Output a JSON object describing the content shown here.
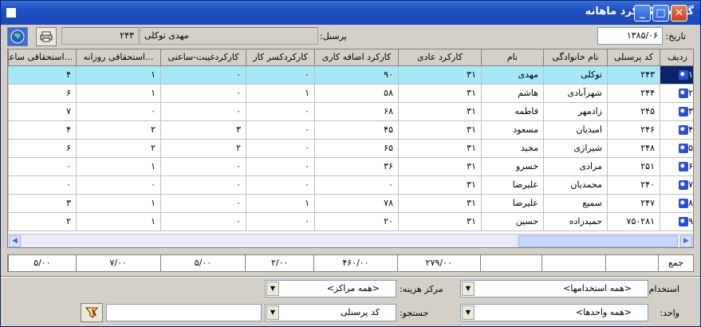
{
  "window": {
    "title": "گزارش کارکرد ماهانه"
  },
  "header": {
    "date_label": "تاریخ:",
    "date_value": "۱۳۸۵/۰۶",
    "personnel_label": "پرسنل:",
    "personnel_name": "مهدی   توکلی",
    "personnel_code": "۲۴۳"
  },
  "grid": {
    "columns": [
      "ردیف",
      "کد پرسنلی",
      "نام خانوادگی",
      "نام",
      "کارکرد عادی",
      "کارکرد اضافه کاری",
      "کارکردکسر کار",
      "کارکردغیبت-ساعتی",
      "...استحقاقی روزانه",
      "...استحقاقی ساعتی"
    ],
    "rows": [
      [
        "۱",
        "۲۴۳",
        "توکلی",
        "مهدی",
        "۳۱",
        "۹۰",
        "۰",
        "۰",
        "۱",
        "۴"
      ],
      [
        "۲",
        "۲۴۴",
        "شهرآبادی",
        "هاشم",
        "۳۱",
        "۵۸",
        "۱",
        "۰",
        "۱",
        "۶"
      ],
      [
        "۳",
        "۲۴۵",
        "زادمهر",
        "فاطمه",
        "۳۱",
        "۶۸",
        "۰",
        "۰",
        "۰",
        "۷"
      ],
      [
        "۴",
        "۲۴۶",
        "امیدیان",
        "مسعود",
        "۳۱",
        "۴۵",
        "۰",
        "۳",
        "۲",
        "۴"
      ],
      [
        "۵",
        "۲۴۸",
        "شیرازی",
        "مجید",
        "۳۱",
        "۶۵",
        "۰",
        "۲",
        "۲",
        "۶"
      ],
      [
        "۶",
        "۲۵۱",
        "مرادی",
        "خسرو",
        "۳۱",
        "۳۶",
        "۰",
        "۰",
        "۱",
        "۰"
      ],
      [
        "۷",
        "۲۴۰",
        "محمدیان",
        "علیرضا",
        "۳۱",
        "۰",
        "۰",
        "۰",
        "۰",
        "۰"
      ],
      [
        "۸",
        "۲۴۷",
        "سمیع",
        "علیرضا",
        "۳۱",
        "۷۸",
        "۱",
        "۰",
        "۱",
        "۳"
      ],
      [
        "۹",
        "۷۵۰۲۸۱",
        "حمیدزاده",
        "حسین",
        "۳۱",
        "۲۰",
        "۰",
        "۰",
        "۱",
        "۲"
      ]
    ]
  },
  "totals": [
    "جمع",
    "",
    "",
    "",
    "۲۷۹/۰۰",
    "۴۶۰/۰۰",
    "۲/۰۰",
    "۵/۰۰",
    "۷/۰۰",
    "۵/۰۰"
  ],
  "filters": {
    "employment_label": "استخدام:",
    "employment_value": "<همه استخدامها>",
    "cost_center_label": "مرکز هزینه:",
    "cost_center_value": "<همه مراکز>",
    "unit_label": "واحد:",
    "unit_value": "<همه واحدها>",
    "search_label": "جستجو:",
    "search_by_value": "کد پرسنلی",
    "search_input_value": ""
  },
  "icons": {
    "globe": "globe-icon",
    "print": "printer-icon",
    "filter": "filter-icon"
  }
}
